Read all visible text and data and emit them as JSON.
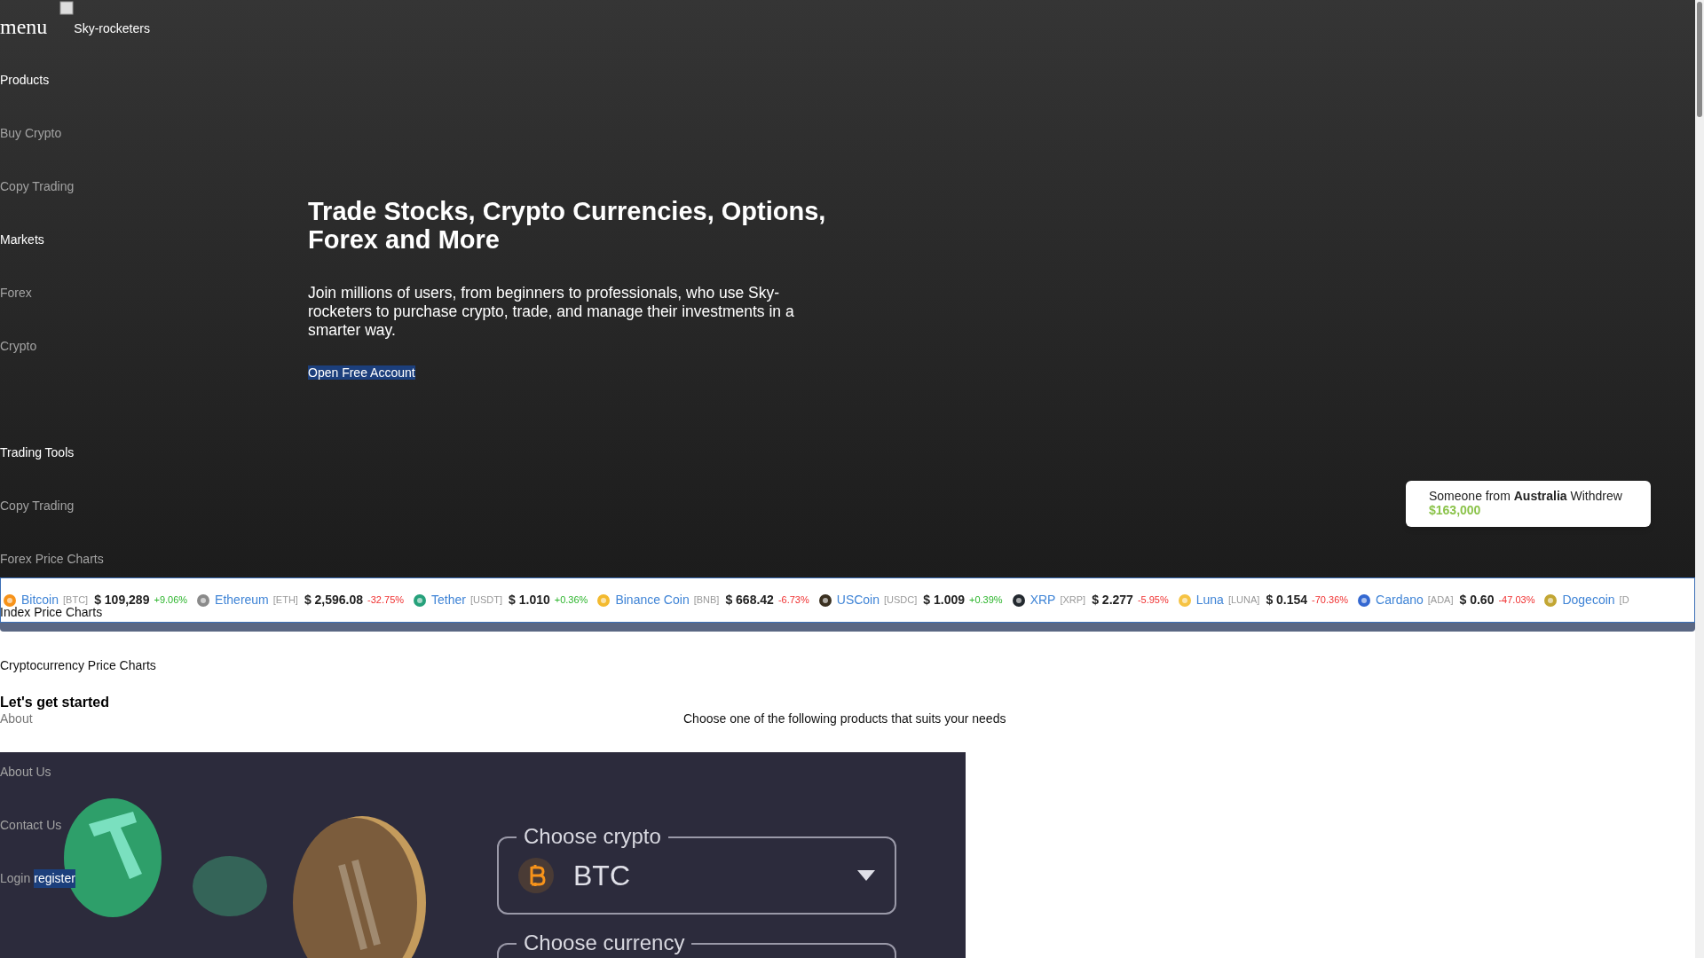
{
  "header": {
    "menu_label": "menu",
    "logo_text": "Sky-rocketers"
  },
  "nav": [
    {
      "label": "Products",
      "kind": "heading"
    },
    {
      "label": "Buy Crypto",
      "kind": "link"
    },
    {
      "label": "Copy Trading",
      "kind": "link"
    },
    {
      "label": "Markets",
      "kind": "heading"
    },
    {
      "label": "Forex",
      "kind": "link"
    },
    {
      "label": "Crypto",
      "kind": "link"
    },
    {
      "kind": "gap"
    },
    {
      "label": "Trading Tools",
      "kind": "heading"
    },
    {
      "label": "Copy Trading",
      "kind": "link"
    },
    {
      "label": "Forex Price Charts",
      "kind": "link"
    },
    {
      "label": "Index Price Charts",
      "kind": "dark"
    },
    {
      "label": "Cryptocurrency Price Charts",
      "kind": "dark"
    },
    {
      "label": "About",
      "kind": "pale"
    },
    {
      "label": "About Us",
      "kind": "link"
    },
    {
      "label": "Contact Us",
      "kind": "link"
    }
  ],
  "auth": {
    "login": "Login",
    "register": "register"
  },
  "hero": {
    "title": "Trade Stocks, Crypto Currencies, Options, Forex and More",
    "text": "Join millions of users, from beginners to professionals, who use Sky-rocketers to purchase crypto, trade, and manage their investments in a smarter way.",
    "cta": "Open Free Account"
  },
  "notification": {
    "text": "Someone from **Australia** Withdrew",
    "amount": "$163,000"
  },
  "ticker": [
    {
      "name": "Bitcoin",
      "symbol": "[BTC]",
      "price": "$ 109,289",
      "change": "+9.06%",
      "up": true,
      "color": "#f7931a"
    },
    {
      "name": "Ethereum",
      "symbol": "[ETH]",
      "price": "$ 2,596.08",
      "change": "-32.75%",
      "up": false,
      "color": "#8a8a8a"
    },
    {
      "name": "Tether",
      "symbol": "[USDT]",
      "price": "$ 1.010",
      "change": "+0.36%",
      "up": true,
      "color": "#26a17b"
    },
    {
      "name": "Binance Coin",
      "symbol": "[BNB]",
      "price": "$ 668.42",
      "change": "-6.73%",
      "up": false,
      "color": "#f3ba2f"
    },
    {
      "name": "USCoin",
      "symbol": "[USDC]",
      "price": "$ 1.009",
      "change": "+0.39%",
      "up": true,
      "color": "#3a3020"
    },
    {
      "name": "XRP",
      "symbol": "[XRP]",
      "price": "$ 2.277",
      "change": "-5.95%",
      "up": false,
      "color": "#23292f"
    },
    {
      "name": "Luna",
      "symbol": "[LUNA]",
      "price": "$ 0.154",
      "change": "-70.36%",
      "up": false,
      "color": "#f6c343"
    },
    {
      "name": "Cardano",
      "symbol": "[ADA]",
      "price": "$ 0.60",
      "change": "-47.03%",
      "up": false,
      "color": "#3468d1"
    },
    {
      "name": "Dogecoin",
      "symbol": "[D",
      "color": "#c2a633"
    }
  ],
  "started": {
    "title": "Let's get started",
    "subtitle": "Choose one of the following products that suits your needs"
  },
  "converter": {
    "crypto_label": "Choose crypto",
    "crypto_value": "BTC",
    "currency_label": "Choose currency"
  }
}
